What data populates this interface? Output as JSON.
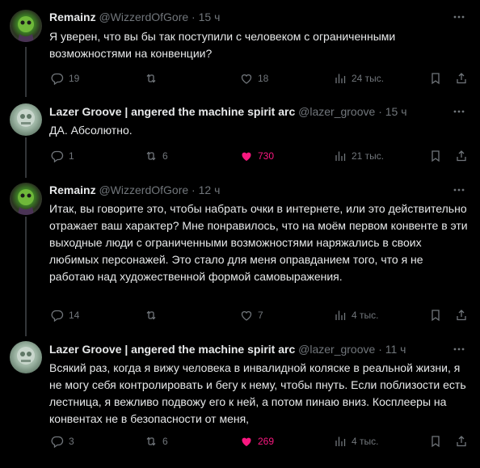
{
  "tweets": [
    {
      "author": "Remainz",
      "handle": "@WizzerdOfGore",
      "dot": "·",
      "time": "15 ч",
      "text": "Я уверен, что вы бы так поступили с человеком с ограниченными возможностями на конвенции?",
      "replies": "19",
      "reposts": "",
      "likes": "18",
      "views": "24 тыс."
    },
    {
      "author": "Lazer Groove | angered the machine spirit arc",
      "handle": "@lazer_groove",
      "dot": "·",
      "time": "15 ч",
      "text": "ДА. Абсолютно.",
      "replies": "1",
      "reposts": "6",
      "likes": "730",
      "views": "21 тыс."
    },
    {
      "author": "Remainz",
      "handle": "@WizzerdOfGore",
      "dot": "·",
      "time": "12 ч",
      "text": "Итак, вы говорите это, чтобы набрать очки в интернете, или это действительно отражает ваш характер? Мне понравилось, что на моём первом конвенте в эти выходные люди с ограниченными возможностями наряжались в своих любимых персонажей. Это стало для меня оправданием того, что я не работаю над художественной формой самовыражения.",
      "replies": "14",
      "reposts": "",
      "likes": "7",
      "views": "4 тыс."
    },
    {
      "author": "Lazer Groove | angered the machine spirit arc",
      "handle": "@lazer_groove",
      "dot": "·",
      "time": "11 ч",
      "text": "Всякий раз, когда я вижу человека в инвалидной коляске в реальной жизни, я не могу себя контролировать и бегу к нему, чтобы пнуть. Если поблизости есть лестница, я вежливо подвожу его к ней, а потом пинаю вниз. Косплееры на конвентах не в безопасности от меня,",
      "replies": "3",
      "reposts": "6",
      "likes": "269",
      "views": "4 тыс."
    }
  ],
  "colors": {
    "background": "#000000",
    "text": "#e7e9ea",
    "muted": "#71767b",
    "like_active": "#f91880",
    "thread_line": "#333639"
  },
  "icons": [
    "more-icon",
    "reply-icon",
    "repost-icon",
    "like-icon",
    "views-icon",
    "bookmark-icon",
    "share-icon"
  ]
}
